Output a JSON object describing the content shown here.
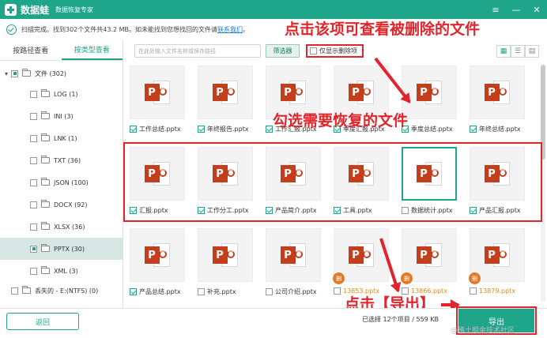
{
  "app": {
    "name": "数据蛙",
    "subtitle": "数据恢复专家"
  },
  "window_buttons": [
    "≡",
    "—",
    "✕"
  ],
  "status": {
    "text": "扫描完成。找到302个文件共43.2 MB。如未能找到您想找回的文件请",
    "link": "联系我们",
    "suffix": "。"
  },
  "annotations": {
    "top": "点击该项可查看被删除的文件",
    "middle": "勾选需要恢复的文件",
    "bottom": "点击【导出】"
  },
  "left_tabs": [
    "按路径查看",
    "按类型查看"
  ],
  "tree": {
    "root": "文件 (302)",
    "children": [
      "LOG (1)",
      "INI (3)",
      "LNK (1)",
      "TXT (36)",
      "JSON (100)",
      "DOCX (92)",
      "XLSX (36)",
      "PPTX (30)",
      "XML (3)"
    ],
    "selected": "PPTX (30)",
    "lost": "丢失的 - E:(NTFS) (0)"
  },
  "toolbar": {
    "search_placeholder": "在此处输入文件名称或保存路径",
    "filter_label": "筛选器",
    "deleted_only_label": "仅显示删除项"
  },
  "files": {
    "row1": [
      {
        "name": "工作总结.pptx",
        "checked": true
      },
      {
        "name": "年终报告.pptx",
        "checked": true
      },
      {
        "name": "工作汇报.pptx",
        "checked": true
      },
      {
        "name": "季度汇报.pptx",
        "checked": true
      },
      {
        "name": "季度总结.pptx",
        "checked": true
      },
      {
        "name": "年终总结.pptx",
        "checked": true
      }
    ],
    "row2": [
      {
        "name": "汇报.pptx",
        "checked": true
      },
      {
        "name": "工作分工.pptx",
        "checked": true
      },
      {
        "name": "产品简介.pptx",
        "checked": true
      },
      {
        "name": "工具.pptx",
        "checked": true
      },
      {
        "name": "数据统计.pptx",
        "checked": false
      },
      {
        "name": "产品汇报.pptx",
        "checked": true
      }
    ],
    "row3": [
      {
        "name": "产品总结.pptx",
        "checked": true,
        "deleted": false
      },
      {
        "name": "补充.pptx",
        "checked": false,
        "deleted": false
      },
      {
        "name": "公司介绍.pptx",
        "checked": false,
        "deleted": false
      },
      {
        "name": "13853.pptx",
        "checked": false,
        "deleted": true
      },
      {
        "name": "13866.pptx",
        "checked": false,
        "deleted": true
      },
      {
        "name": "13879.pptx",
        "checked": false,
        "deleted": true
      }
    ],
    "deleted_badge": "删"
  },
  "bottom": {
    "back_label": "返回",
    "selected_info": "已选择 12个项目 / 559 KB",
    "export_label": "导出",
    "watermark": "@稀土掘金技术社区"
  },
  "colors": {
    "accent": "#1fa58a",
    "annotation": "#e2242b",
    "ppt": "#c43e1c"
  }
}
